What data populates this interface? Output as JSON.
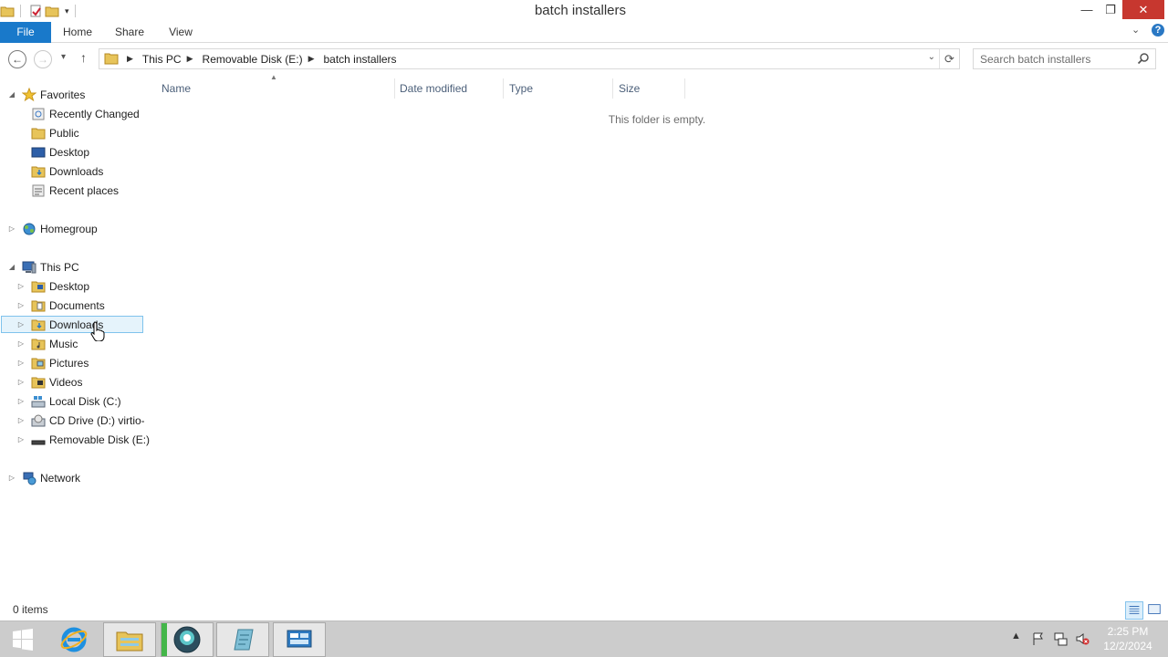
{
  "window": {
    "title": "batch installers",
    "controls": {
      "minimize": "—",
      "maximize": "❐",
      "close": "✕"
    }
  },
  "ribbon": {
    "tabs": [
      {
        "label": "File",
        "active": true
      },
      {
        "label": "Home"
      },
      {
        "label": "Share"
      },
      {
        "label": "View"
      }
    ],
    "accent_color": "#1979ca"
  },
  "address": {
    "crumbs": [
      "This PC",
      "Removable Disk (E:)",
      "batch installers"
    ],
    "search_placeholder": "Search batch installers"
  },
  "navigation": {
    "favorites": {
      "label": "Favorites",
      "items": [
        "Recently Changed",
        "Public",
        "Desktop",
        "Downloads",
        "Recent places"
      ]
    },
    "homegroup": {
      "label": "Homegroup"
    },
    "this_pc": {
      "label": "This PC",
      "items": [
        "Desktop",
        "Documents",
        "Downloads",
        "Music",
        "Pictures",
        "Videos",
        "Local Disk (C:)",
        "CD Drive (D:) virtio-win",
        "Removable Disk (E:)"
      ],
      "selected": "Downloads"
    },
    "network": {
      "label": "Network"
    }
  },
  "content": {
    "columns": [
      "Name",
      "Date modified",
      "Type",
      "Size"
    ],
    "sorted_by": "Name",
    "empty_message": "This folder is empty."
  },
  "status": {
    "item_count": "0 items"
  },
  "taskbar": {
    "apps": [
      "start-icon",
      "internet-explorer-icon",
      "file-explorer-icon",
      "cloud-app-icon",
      "notes-icon",
      "server-manager-icon"
    ],
    "clock_time": "2:25 PM",
    "clock_date": "12/2/2024"
  }
}
